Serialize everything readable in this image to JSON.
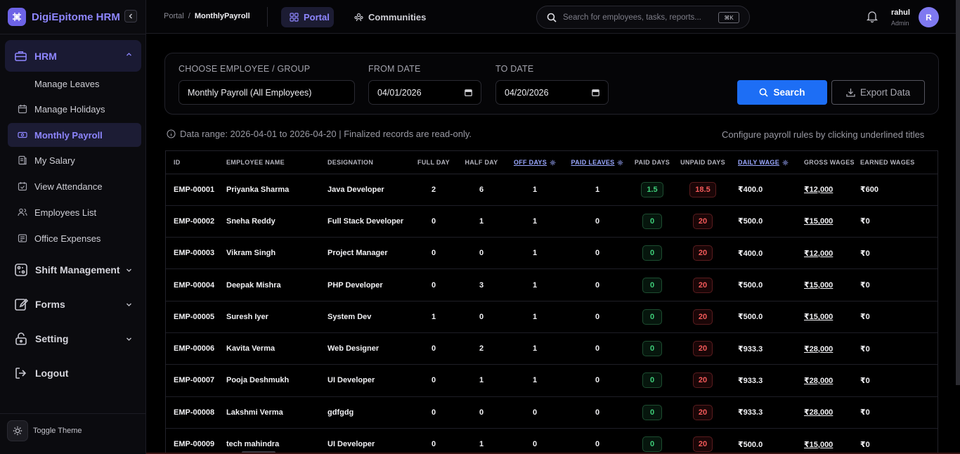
{
  "brand": {
    "name": "DigiEpitome HRM"
  },
  "sidebar": {
    "hrm_label": "HRM",
    "hrm_items": [
      {
        "label": "Manage Leaves",
        "icon": "none"
      },
      {
        "label": "Manage Holidays",
        "icon": "calendar-icon"
      },
      {
        "label": "Monthly Payroll",
        "icon": "payroll-icon"
      },
      {
        "label": "My Salary",
        "icon": "salary-icon"
      },
      {
        "label": "View Attendance",
        "icon": "attendance-icon"
      },
      {
        "label": "Employees List",
        "icon": "users-icon"
      },
      {
        "label": "Office Expenses",
        "icon": "expenses-icon"
      }
    ],
    "groups": [
      {
        "label": "Shift Management",
        "icon": "shift-icon"
      },
      {
        "label": "Forms",
        "icon": "forms-icon"
      },
      {
        "label": "Setting",
        "icon": "lock-icon"
      }
    ],
    "logout_label": "Logout",
    "toggle_theme_label": "Toggle Theme"
  },
  "header": {
    "breadcrumb_root": "Portal",
    "breadcrumb_sep": "/",
    "breadcrumb_current": "MonthlyPayroll",
    "tabs": [
      {
        "label": "Portal"
      },
      {
        "label": "Communities"
      }
    ],
    "search_placeholder": "Search for employees, tasks, reports...",
    "search_shortcut": "⌘K",
    "user_name": "rahul",
    "user_role": "Admin",
    "avatar_initial": "R"
  },
  "filters": {
    "employee_label": "CHOOSE EMPLOYEE / GROUP",
    "employee_value": "Monthly Payroll (All Employees)",
    "from_label": "FROM DATE",
    "from_value": "04/01/2026",
    "to_label": "TO DATE",
    "to_value": "04/20/2026",
    "search_label": "Search",
    "export_label": "Export Data"
  },
  "info": {
    "range_text": "Data range: 2026-04-01 to 2026-04-20 | Finalized records are read-only.",
    "config_text": "Configure payroll rules by clicking underlined titles"
  },
  "table": {
    "columns": [
      "ID",
      "EMPLOYEE NAME",
      "DESIGNATION",
      "FULL DAY",
      "HALF DAY",
      "OFF DAYS",
      "PAID LEAVES",
      "PAID DAYS",
      "UNPAID DAYS",
      "DAILY WAGE",
      "GROSS WAGES",
      "EARNED WAGES"
    ],
    "rows": [
      {
        "id": "EMP-00001",
        "name": "Priyanka Sharma",
        "designation": "Java Developer",
        "full": "2",
        "half": "6",
        "off": "1",
        "paid_leaves": "1",
        "paid_days": "1.5",
        "unpaid": "18.5",
        "daily": "₹400.0",
        "gross": "₹12,000",
        "earned": "₹600"
      },
      {
        "id": "EMP-00002",
        "name": "Sneha Reddy",
        "designation": "Full Stack Developer",
        "full": "0",
        "half": "1",
        "off": "1",
        "paid_leaves": "0",
        "paid_days": "0",
        "unpaid": "20",
        "daily": "₹500.0",
        "gross": "₹15,000",
        "earned": "₹0"
      },
      {
        "id": "EMP-00003",
        "name": "Vikram Singh",
        "designation": "Project Manager",
        "full": "0",
        "half": "0",
        "off": "1",
        "paid_leaves": "0",
        "paid_days": "0",
        "unpaid": "20",
        "daily": "₹400.0",
        "gross": "₹12,000",
        "earned": "₹0"
      },
      {
        "id": "EMP-00004",
        "name": "Deepak Mishra",
        "designation": "PHP Developer",
        "full": "0",
        "half": "3",
        "off": "1",
        "paid_leaves": "0",
        "paid_days": "0",
        "unpaid": "20",
        "daily": "₹500.0",
        "gross": "₹15,000",
        "earned": "₹0"
      },
      {
        "id": "EMP-00005",
        "name": "Suresh Iyer",
        "designation": "System Dev",
        "full": "1",
        "half": "0",
        "off": "1",
        "paid_leaves": "0",
        "paid_days": "0",
        "unpaid": "20",
        "daily": "₹500.0",
        "gross": "₹15,000",
        "earned": "₹0"
      },
      {
        "id": "EMP-00006",
        "name": "Kavita Verma",
        "designation": "Web Designer",
        "full": "0",
        "half": "2",
        "off": "1",
        "paid_leaves": "0",
        "paid_days": "0",
        "unpaid": "20",
        "daily": "₹933.3",
        "gross": "₹28,000",
        "earned": "₹0"
      },
      {
        "id": "EMP-00007",
        "name": "Pooja Deshmukh",
        "designation": "UI Developer",
        "full": "0",
        "half": "1",
        "off": "1",
        "paid_leaves": "0",
        "paid_days": "0",
        "unpaid": "20",
        "daily": "₹933.3",
        "gross": "₹28,000",
        "earned": "₹0"
      },
      {
        "id": "EMP-00008",
        "name": "Lakshmi Verma",
        "designation": "gdfgdg",
        "full": "0",
        "half": "0",
        "off": "0",
        "paid_leaves": "0",
        "paid_days": "0",
        "unpaid": "20",
        "daily": "₹933.3",
        "gross": "₹28,000",
        "earned": "₹0"
      },
      {
        "id": "EMP-00009",
        "name": "tech mahindra",
        "designation": "UI Developer",
        "full": "0",
        "half": "1",
        "off": "0",
        "paid_leaves": "0",
        "paid_days": "0",
        "unpaid": "20",
        "daily": "₹500.0",
        "gross": "₹15,000",
        "earned": "₹0"
      }
    ]
  },
  "colors": {
    "accent": "#8e86ff",
    "primary_button": "#1d6ef5",
    "paid_green": "#3fd07a",
    "unpaid_red": "#f55a5a"
  }
}
